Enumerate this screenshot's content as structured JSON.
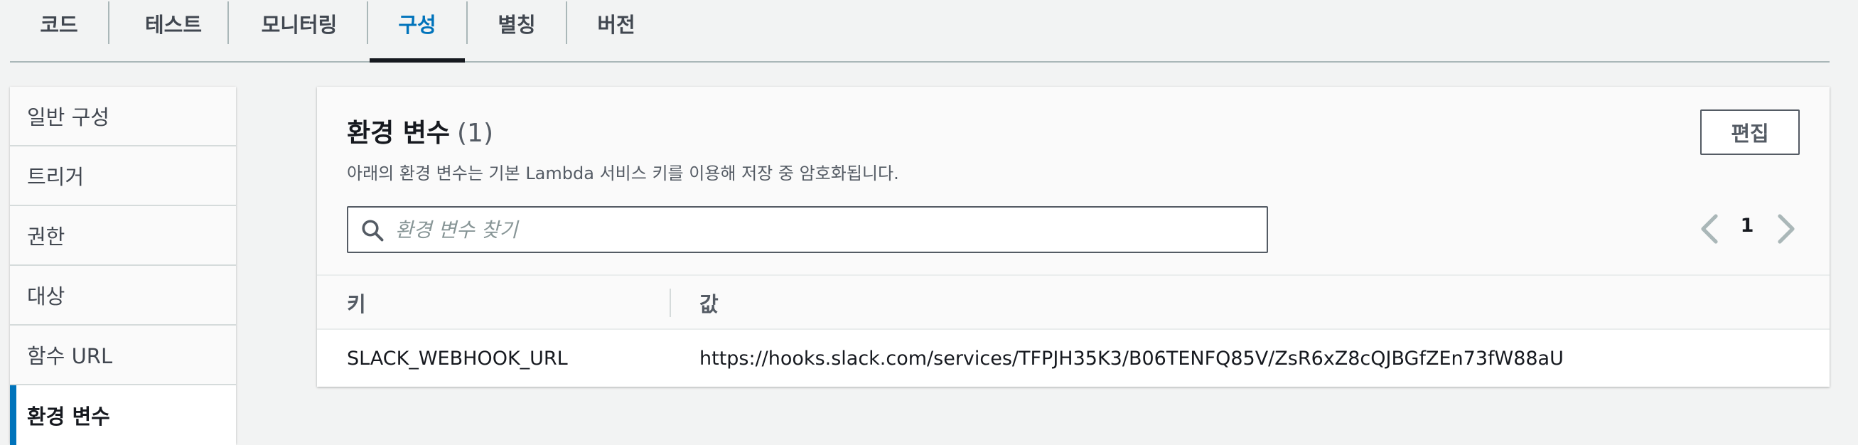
{
  "tabs": [
    {
      "label": "코드",
      "active": false
    },
    {
      "label": "테스트",
      "active": false
    },
    {
      "label": "모니터링",
      "active": false
    },
    {
      "label": "구성",
      "active": true
    },
    {
      "label": "별칭",
      "active": false
    },
    {
      "label": "버전",
      "active": false
    }
  ],
  "side_nav": {
    "items": [
      {
        "label": "일반 구성",
        "active": false
      },
      {
        "label": "트리거",
        "active": false
      },
      {
        "label": "권한",
        "active": false
      },
      {
        "label": "대상",
        "active": false
      },
      {
        "label": "함수 URL",
        "active": false
      },
      {
        "label": "환경 변수",
        "active": true
      }
    ]
  },
  "panel": {
    "title": "환경 변수",
    "count": "(1)",
    "description": "아래의 환경 변수는 기본 Lambda 서비스 키를 이용해 저장 중 암호화됩니다.",
    "edit_label": "편집",
    "search": {
      "placeholder": "환경 변수 찾기",
      "icon": "search-icon"
    },
    "pagination": {
      "current_page": "1",
      "prev_icon": "chevron-left-icon",
      "next_icon": "chevron-right-icon"
    },
    "table": {
      "columns": [
        "키",
        "값"
      ],
      "rows": [
        {
          "key": "SLACK_WEBHOOK_URL",
          "value": "https://hooks.slack.com/services/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"
        }
      ]
    }
  },
  "colors": {
    "accent": "#0073bb",
    "background": "#f2f3f3",
    "text": "#16191f",
    "muted": "#545b64"
  }
}
